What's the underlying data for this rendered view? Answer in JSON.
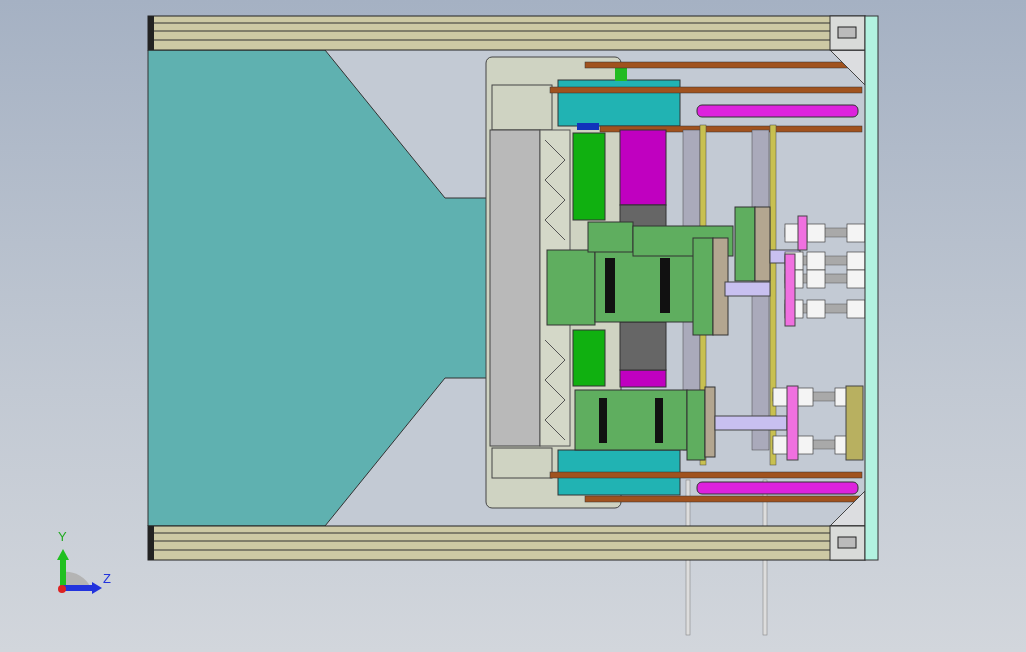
{
  "viewport": {
    "triad": {
      "axes": [
        {
          "kind": "y",
          "label": "Y"
        },
        {
          "kind": "z",
          "label": "Z"
        }
      ]
    }
  }
}
